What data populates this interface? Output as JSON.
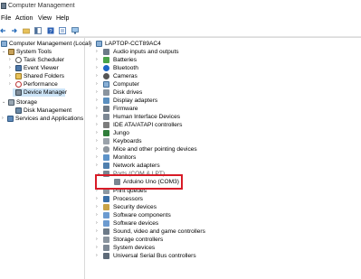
{
  "window": {
    "title": "Computer Management"
  },
  "menu": {
    "file": "File",
    "action": "Action",
    "view": "View",
    "help": "Help"
  },
  "left_tree": {
    "root": "Computer Management (Local)",
    "system_tools": "System Tools",
    "task_scheduler": "Task Scheduler",
    "event_viewer": "Event Viewer",
    "shared_folders": "Shared Folders",
    "performance": "Performance",
    "device_manager": "Device Manager",
    "storage": "Storage",
    "disk_management": "Disk Management",
    "services_apps": "Services and Applications"
  },
  "device_tree": {
    "computer": "LAPTOP-CCT89AC4",
    "categories": [
      "Audio inputs and outputs",
      "Batteries",
      "Bluetooth",
      "Cameras",
      "Computer",
      "Disk drives",
      "Display adapters",
      "Firmware",
      "Human Interface Devices",
      "IDE ATA/ATAPI controllers",
      "Jungo",
      "Keyboards",
      "Mice and other pointing devices",
      "Monitors",
      "Network adapters",
      "Ports (COM & LPT)",
      "Print queues",
      "Processors",
      "Security devices",
      "Software components",
      "Software devices",
      "Sound, video and game controllers",
      "Storage controllers",
      "System devices",
      "Universal Serial Bus controllers"
    ],
    "port_child": "Arduino Uno (COM3)"
  },
  "colors": {
    "selection": "#cce4f7",
    "highlight_box": "#d81b27"
  }
}
